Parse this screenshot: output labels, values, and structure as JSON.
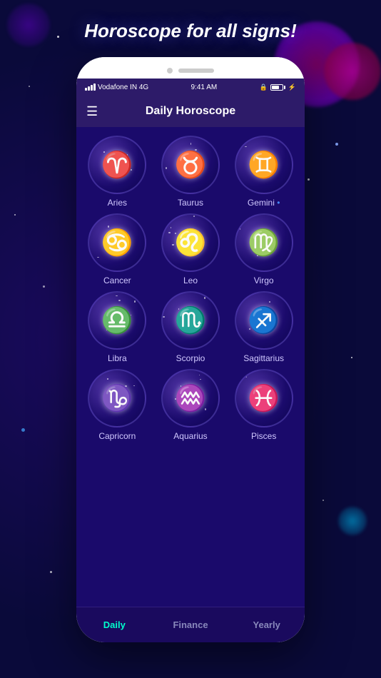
{
  "app": {
    "main_title": "Horoscope for all signs!",
    "header_title": "Daily Horoscope",
    "menu_icon": "☰"
  },
  "status_bar": {
    "carrier": "Vodafone IN 4G",
    "time": "9:41 AM",
    "lock_icon": "🔒"
  },
  "signs": [
    {
      "id": "aries",
      "name": "Aries",
      "symbol": "♈",
      "has_dot": false
    },
    {
      "id": "taurus",
      "name": "Taurus",
      "symbol": "♉",
      "has_dot": false
    },
    {
      "id": "gemini",
      "name": "Gemini",
      "symbol": "♊",
      "has_dot": true
    },
    {
      "id": "cancer",
      "name": "Cancer",
      "symbol": "♋",
      "has_dot": false
    },
    {
      "id": "leo",
      "name": "Leo",
      "symbol": "♌",
      "has_dot": false
    },
    {
      "id": "virgo",
      "name": "Virgo",
      "symbol": "♍",
      "has_dot": false
    },
    {
      "id": "libra",
      "name": "Libra",
      "symbol": "♎",
      "has_dot": false
    },
    {
      "id": "scorpio",
      "name": "Scorpio",
      "symbol": "♏",
      "has_dot": false
    },
    {
      "id": "sagittarius",
      "name": "Sagittarius",
      "symbol": "♐",
      "has_dot": false
    },
    {
      "id": "capricorn",
      "name": "Capricorn",
      "symbol": "♑",
      "has_dot": false
    },
    {
      "id": "aquarius",
      "name": "Aquarius",
      "symbol": "♒",
      "has_dot": false
    },
    {
      "id": "pisces",
      "name": "Pisces",
      "symbol": "♓",
      "has_dot": false
    }
  ],
  "bottom_nav": [
    {
      "id": "daily",
      "label": "Daily",
      "active": true
    },
    {
      "id": "finance",
      "label": "Finance",
      "active": false
    },
    {
      "id": "yearly",
      "label": "Yearly",
      "active": false
    }
  ]
}
